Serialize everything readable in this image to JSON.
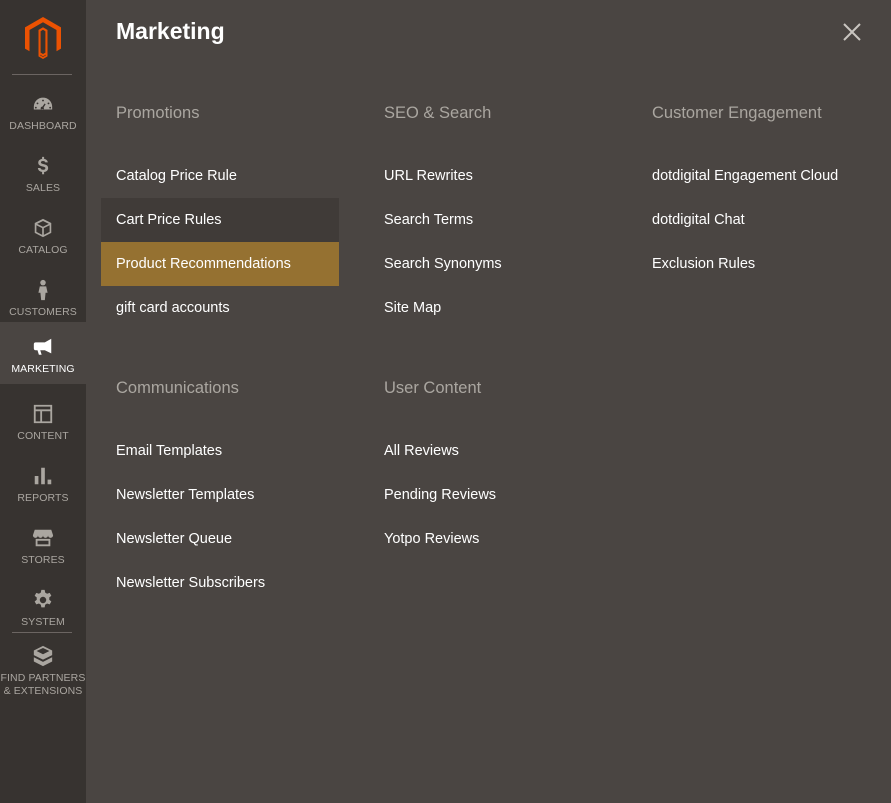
{
  "sidebar": {
    "items": [
      {
        "id": "dashboard",
        "label": "DASHBOARD"
      },
      {
        "id": "sales",
        "label": "SALES"
      },
      {
        "id": "catalog",
        "label": "CATALOG"
      },
      {
        "id": "customers",
        "label": "CUSTOMERS"
      },
      {
        "id": "marketing",
        "label": "MARKETING",
        "active": true
      },
      {
        "id": "content",
        "label": "CONTENT"
      },
      {
        "id": "reports",
        "label": "REPORTS"
      },
      {
        "id": "stores",
        "label": "STORES"
      },
      {
        "id": "system",
        "label": "SYSTEM"
      }
    ],
    "partners": {
      "label_line1": "FIND PARTNERS",
      "label_line2": "& EXTENSIONS"
    }
  },
  "panel": {
    "title": "Marketing",
    "groups": [
      {
        "title": "Promotions",
        "items": [
          "Catalog Price Rule",
          "Cart Price Rules",
          "Product Recommendations",
          "gift card accounts"
        ]
      },
      {
        "title": "SEO & Search",
        "items": [
          "URL Rewrites",
          "Search Terms",
          "Search Synonyms",
          "Site Map"
        ]
      },
      {
        "title": "Customer Engagement",
        "items": [
          "dotdigital Engagement Cloud",
          "dotdigital Chat",
          "Exclusion Rules"
        ]
      },
      {
        "title": "Communications",
        "items": [
          "Email Templates",
          "Newsletter Templates",
          "Newsletter Queue",
          "Newsletter Subscribers"
        ]
      },
      {
        "title": "User Content",
        "items": [
          "All Reviews",
          "Pending Reviews",
          "Yotpo Reviews"
        ]
      }
    ],
    "hovered_item": "Cart Price Rules",
    "selected_item": "Product Recommendations"
  },
  "colors": {
    "sidebar_bg": "#373330",
    "panel_bg": "#4a4542",
    "selected_bg": "#957131",
    "logo_orange": "#eb5202"
  },
  "icons": {
    "logo": "magento-logo-icon",
    "close": "close-icon",
    "dashboard": "speedometer-icon",
    "sales": "dollar-icon",
    "catalog": "box-icon",
    "customers": "person-icon",
    "marketing": "megaphone-icon",
    "content": "layout-icon",
    "reports": "bar-chart-icon",
    "stores": "storefront-icon",
    "system": "gear-icon",
    "partners": "blocks-icon"
  }
}
